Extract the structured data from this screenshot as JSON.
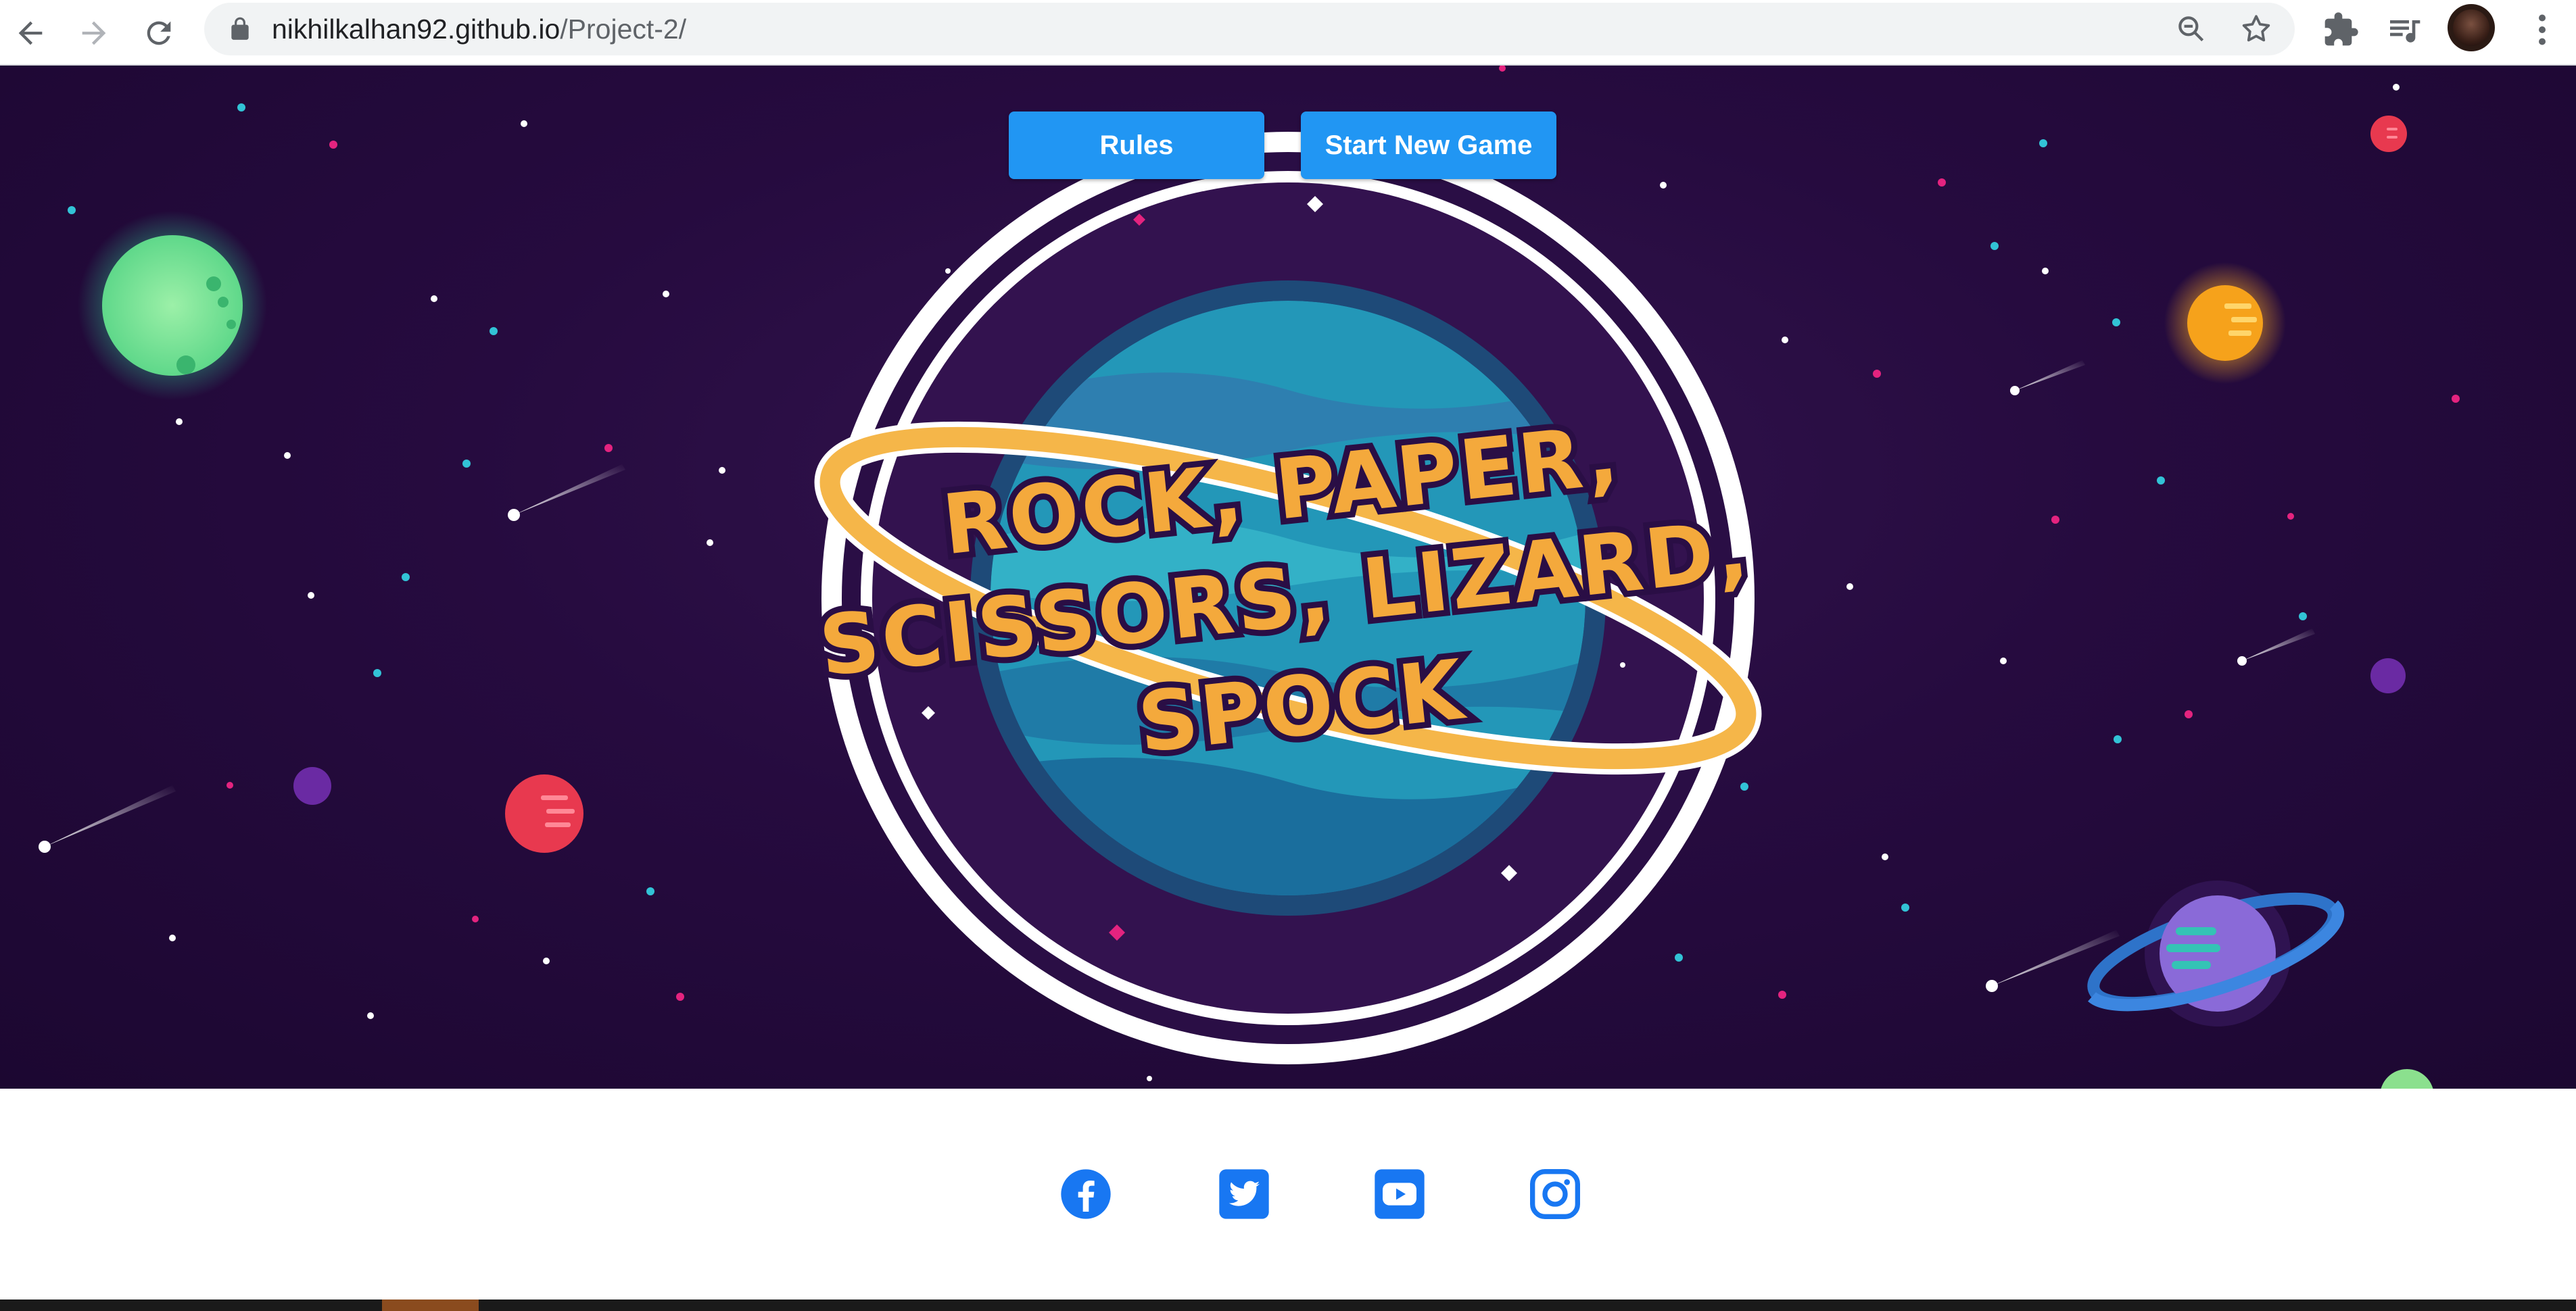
{
  "browser": {
    "url_host": "nikhilkalhan92.github.io",
    "url_path": "/Project-2/",
    "icons": [
      "back-icon",
      "forward-icon",
      "reload-icon",
      "lock-icon",
      "zoom-icon",
      "star-icon",
      "extensions-icon",
      "media-icon",
      "avatar",
      "menu-icon"
    ]
  },
  "hero": {
    "logo_lines": [
      "ROCK, PAPER,",
      "SCISSORS, LIZARD,",
      "SPOCK"
    ],
    "buttons": {
      "rules": "Rules",
      "new_game": "Start New Game"
    }
  },
  "footer": {
    "social": [
      "facebook-icon",
      "twitter-icon",
      "youtube-icon",
      "instagram-icon"
    ]
  },
  "colors": {
    "button": "#2196f3",
    "space": "#260b3f",
    "logo_text": "#f4a93c",
    "social": "#1877f2"
  }
}
